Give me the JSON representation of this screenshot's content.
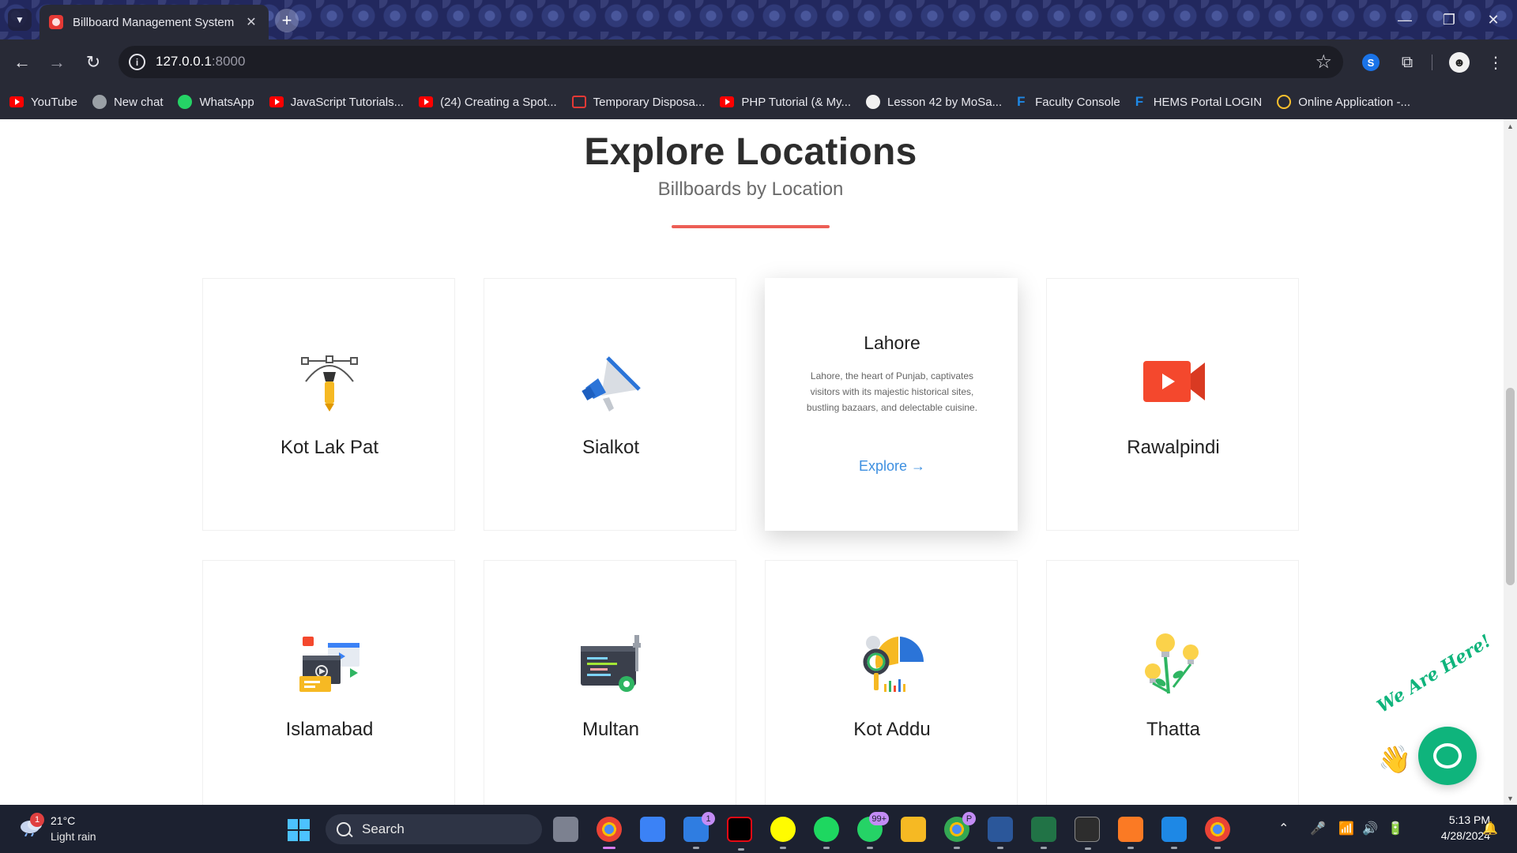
{
  "browser": {
    "tab_title": "Billboard Management System",
    "tab_close": "✕",
    "new_tab": "+",
    "url_host": "127.0.0.1",
    "url_port": ":8000",
    "bookmarks": [
      {
        "label": "YouTube",
        "icon": "youtube-icon"
      },
      {
        "label": "New chat",
        "icon": "chatgpt-icon"
      },
      {
        "label": "WhatsApp",
        "icon": "whatsapp-icon"
      },
      {
        "label": "JavaScript Tutorials...",
        "icon": "youtube-icon"
      },
      {
        "label": "(24) Creating a Spot...",
        "icon": "youtube-icon"
      },
      {
        "label": "Temporary Disposa...",
        "icon": "mail-icon"
      },
      {
        "label": "PHP Tutorial (& My...",
        "icon": "youtube-icon"
      },
      {
        "label": "Lesson 42 by MoSa...",
        "icon": "github-icon"
      },
      {
        "label": "Faculty Console",
        "icon": "f-icon"
      },
      {
        "label": "HEMS Portal LOGIN",
        "icon": "f-icon"
      },
      {
        "label": "Online Application -...",
        "icon": "ring-icon"
      }
    ]
  },
  "section": {
    "title": "Explore Locations",
    "subtitle": "Billboards by Location",
    "accent_color": "#ec5e55"
  },
  "locations": [
    {
      "name": "Kot Lak Pat",
      "icon": "pen-tool-icon"
    },
    {
      "name": "Sialkot",
      "icon": "megaphone-icon"
    },
    {
      "name": "Lahore",
      "icon": "none",
      "description": "Lahore, the heart of Punjab, captivates visitors with its majestic historical sites, bustling bazaars, and delectable cuisine.",
      "link": "Explore →",
      "active": true
    },
    {
      "name": "Rawalpindi",
      "icon": "video-camera-icon"
    },
    {
      "name": "Islamabad",
      "icon": "media-windows-icon"
    },
    {
      "name": "Multan",
      "icon": "code-editor-icon"
    },
    {
      "name": "Kot Addu",
      "icon": "analytics-magnifier-icon"
    },
    {
      "name": "Thatta",
      "icon": "lightbulb-plant-icon"
    }
  ],
  "chat_widget": {
    "label": "We Are Here!",
    "wave": "👋"
  },
  "taskbar": {
    "weather_badge": "1",
    "temperature": "21°C",
    "weather": "Light rain",
    "search_label": "Search",
    "mail_badge": "1",
    "whatsapp_badge": "99+",
    "chrome_profile_badge": "P",
    "time": "5:13 PM",
    "date": "4/28/2024"
  }
}
